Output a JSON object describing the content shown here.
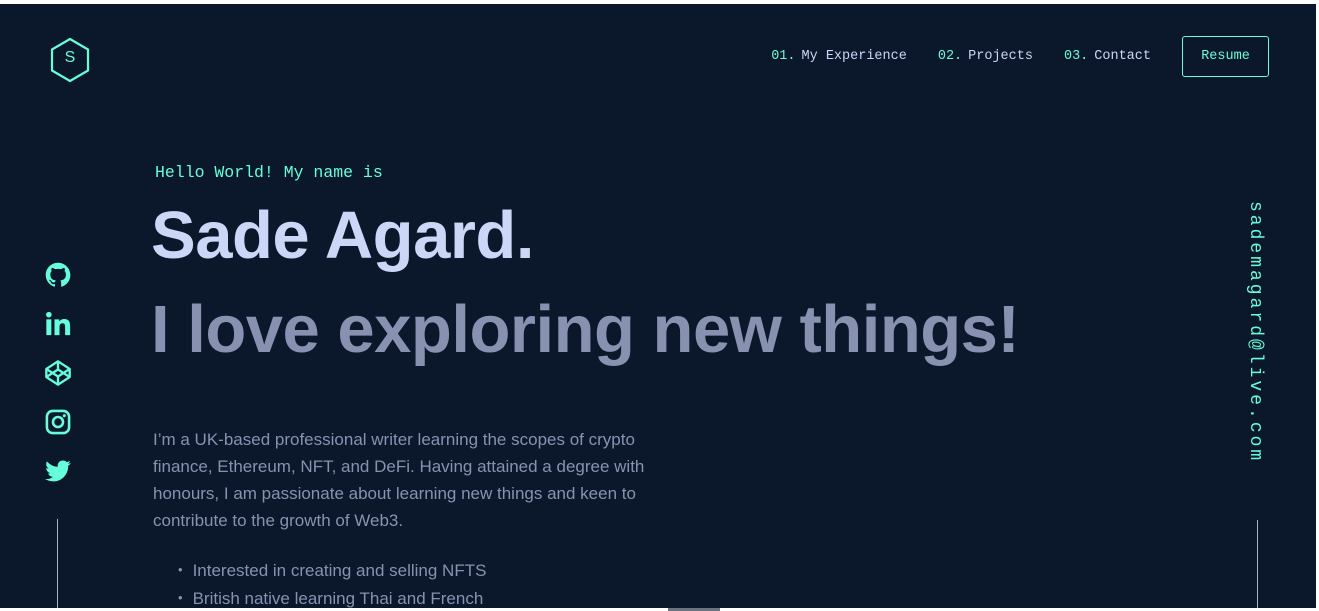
{
  "logo": {
    "letter": "S"
  },
  "nav": {
    "items": [
      {
        "num": "01.",
        "label": "My Experience"
      },
      {
        "num": "02.",
        "label": "Projects"
      },
      {
        "num": "03.",
        "label": "Contact"
      }
    ],
    "resume_label": "Resume"
  },
  "hero": {
    "greeting": "Hello World! My name is",
    "name": "Sade Agard.",
    "tagline": "I love exploring new things!",
    "bio": "I’m a UK-based professional writer learning the scopes of crypto finance, Ethereum, NFT, and DeFi. Having attained a degree with honours, I am passionate about learning new things and keen to contribute to the growth of Web3.",
    "bullets": [
      "Interested in creating and selling NFTS",
      "British native learning Thai and French"
    ]
  },
  "socials": [
    {
      "icon": "github-icon"
    },
    {
      "icon": "linkedin-icon"
    },
    {
      "icon": "codepen-icon"
    },
    {
      "icon": "instagram-icon"
    },
    {
      "icon": "twitter-icon"
    }
  ],
  "email": "sademagard@live.com",
  "colors": {
    "background": "#0b172a",
    "accent": "#64ffda",
    "heading": "#ccd6f6",
    "text": "#8892b0"
  }
}
